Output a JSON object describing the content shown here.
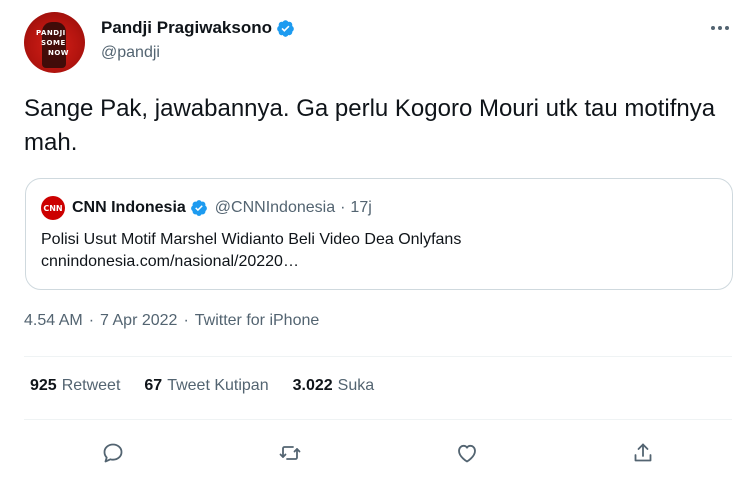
{
  "author": {
    "display_name": "Pandji Pragiwaksono",
    "handle": "@pandji",
    "avatar_text": [
      "PANDJI",
      "SOME",
      "NOW"
    ]
  },
  "tweet": {
    "text": "Sange Pak, jawabannya. Ga perlu Kogoro Mouri utk tau motifnya mah."
  },
  "quoted": {
    "logo_text": "CNN",
    "name": "CNN Indonesia",
    "handle": "@CNNIndonesia",
    "separator": "·",
    "time": "17j",
    "text": "Polisi Usut Motif Marshel Widianto Beli Video Dea Onlyfans",
    "link": "cnnindonesia.com/nasional/20220…"
  },
  "meta": {
    "time": "4.54 AM",
    "date": "7 Apr 2022",
    "source": "Twitter for iPhone",
    "separator": "·"
  },
  "stats": {
    "retweets": {
      "count": "925",
      "label": "Retweet"
    },
    "quotes": {
      "count": "67",
      "label": "Tweet Kutipan"
    },
    "likes": {
      "count": "3.022",
      "label": "Suka"
    }
  },
  "colors": {
    "verified": "#1d9bf0",
    "secondary_text": "#536471",
    "border": "#cfd9de",
    "cnn_red": "#cc0000"
  },
  "icons": {
    "more": "more-icon",
    "verified": "verified-badge-icon",
    "reply": "reply-icon",
    "retweet": "retweet-icon",
    "like": "like-icon",
    "share": "share-icon"
  }
}
